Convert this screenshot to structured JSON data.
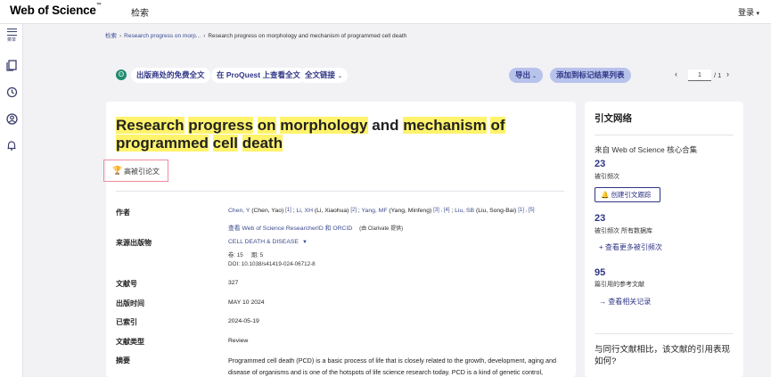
{
  "header": {
    "logo": "Web of Science",
    "logo_tm": "™",
    "search_label": "检索",
    "login_label": "登录",
    "login_caret": "▾"
  },
  "sidebar": {
    "menu_label": "菜单",
    "icons": [
      "menu-icon",
      "document-list-icon",
      "history-icon",
      "user-icon",
      "bell-icon"
    ]
  },
  "breadcrumb": {
    "home": "检索",
    "results": "Research progress on morp...",
    "current": "Research progress on morphology and mechanism of programmed cell death",
    "sep": "›"
  },
  "actions": {
    "publisher_free": "出版商处的免费全文",
    "proquest": "在 ProQuest 上查看全文",
    "full_text_links": "全文链接",
    "export": "导出",
    "add_marked": "添加到标记结果列表",
    "page_current": "1",
    "page_total": "/ 1",
    "prev": "‹",
    "next": "›"
  },
  "record": {
    "title_parts": [
      {
        "text": "Research",
        "hl": true
      },
      {
        "text": " ",
        "hl": false
      },
      {
        "text": "progress",
        "hl": true
      },
      {
        "text": " ",
        "hl": false
      },
      {
        "text": "on",
        "hl": true
      },
      {
        "text": " ",
        "hl": false
      },
      {
        "text": "morphology",
        "hl": true
      },
      {
        "text": " and ",
        "hl": false
      },
      {
        "text": "mechanism",
        "hl": true
      },
      {
        "text": " ",
        "hl": false
      },
      {
        "text": "of",
        "hl": true
      },
      {
        "text": " ",
        "hl": false
      },
      {
        "text": "programmed",
        "hl": true
      },
      {
        "text": " ",
        "hl": false
      },
      {
        "text": "cell",
        "hl": true
      },
      {
        "text": " ",
        "hl": false
      },
      {
        "text": "death",
        "hl": true
      }
    ],
    "highly_cited": "高被引论文",
    "labels": {
      "authors": "作者",
      "source": "来源出版物",
      "article_no": "文献号",
      "pub_date": "出版时间",
      "indexed": "已索引",
      "doc_type": "文献类型",
      "abstract": "摘要"
    },
    "authors": [
      {
        "name": "Chen, Y",
        "full": " (Chen, Yao) ",
        "sup": "[1]",
        "sep": " ; "
      },
      {
        "name": "Li, XH",
        "full": " (Li, Xiaohua) ",
        "sup": "[2]",
        "sep": " ; "
      },
      {
        "name": "Yang, MF",
        "full": " (Yang, Minfeng) ",
        "sup": "[3] , [4]",
        "sep": " ; "
      },
      {
        "name": "Liu, SB",
        "full": " (Liu, Song-Bai) ",
        "sup": "[1] , [5]",
        "sep": ""
      }
    ],
    "rid_link": "查看 Web of Science ResearcherID 和 ORCID",
    "rid_note": "(由 Clarivate 提供)",
    "journal": "CELL DEATH & DISEASE",
    "volume": "卷: 15",
    "issue": "期: 5",
    "doi": "DOI: 10.1038/s41419-024-06712-8",
    "article_no": "327",
    "pub_date": "MAY 10 2024",
    "indexed": "2024-05-19",
    "doc_type": "Review",
    "abstract_line1": "Programmed cell death (PCD) is a basic process of life that is closely related to the growth, development, aging and",
    "abstract_line2": "disease of organisms and is one of the hotspots of life science research today. PCD is a kind of genetic control,"
  },
  "citation_network": {
    "title": "引文网络",
    "source": "来自 Web of Science 核心合集",
    "times_cited": "23",
    "times_cited_label": "被引频次",
    "create_alert": "创建引文跟踪",
    "all_db_count": "23",
    "all_db_label": "被引频次 所有数据库",
    "more_times_cited": "+ 查看更多被引频次",
    "refs_count": "95",
    "refs_label": "篇引用的参考文献",
    "related": "→ 查看相关记录",
    "compare_question": "与同行文献相比，该文献的引用表现如何?"
  },
  "colors": {
    "highlight": "#fff36b",
    "brand_blue": "#2f3585",
    "button_blue": "#b8c3ec",
    "badge_border": "#f08a9b"
  }
}
